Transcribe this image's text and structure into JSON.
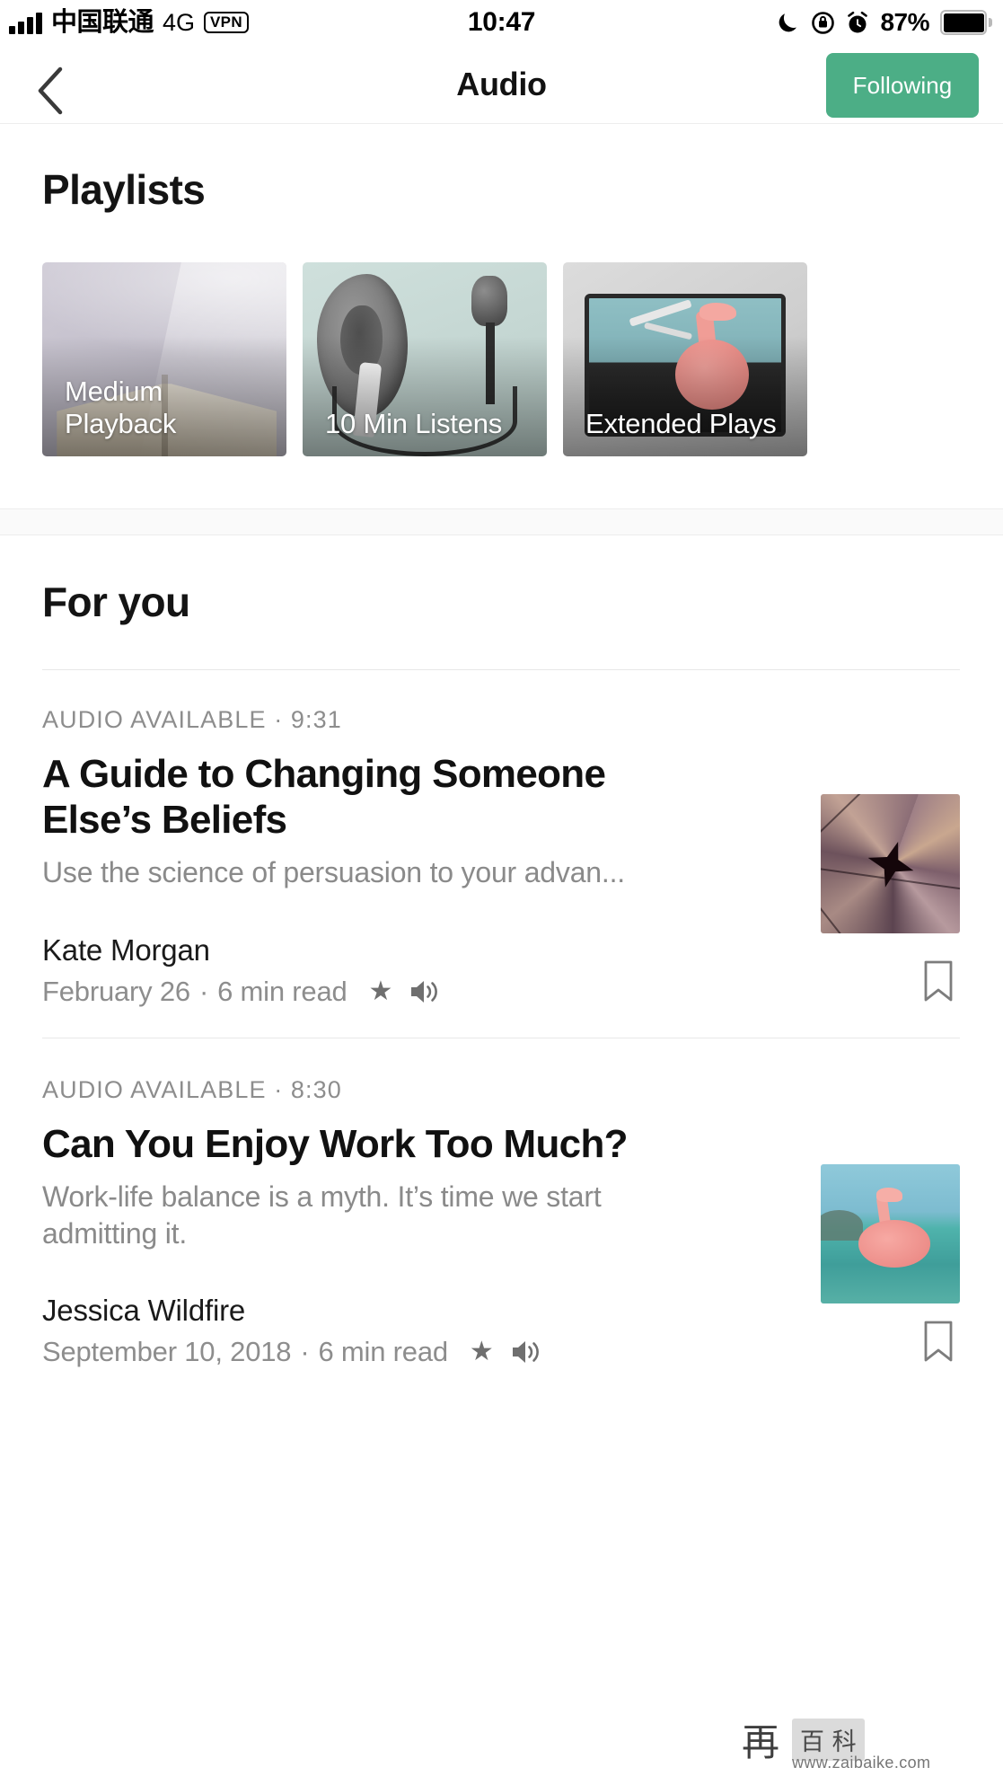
{
  "statusbar": {
    "carrier": "中国联通",
    "network": "4G",
    "vpn_badge": "VPN",
    "time": "10:47",
    "battery_percent": "87%",
    "icons": [
      "signal-bars-icon",
      "moon-icon",
      "rotation-lock-icon",
      "alarm-clock-icon",
      "battery-icon"
    ]
  },
  "navbar": {
    "back_icon": "chevron-left-icon",
    "title": "Audio",
    "follow_button": "Following",
    "accent_color": "#4cae86"
  },
  "playlists": {
    "heading": "Playlists",
    "cards": [
      {
        "label": "Medium\nPlayback",
        "art": "open-book-art"
      },
      {
        "label": "10 Min Listens",
        "art": "ear-earbud-microphone-art"
      },
      {
        "label": "Extended Plays",
        "art": "suitcase-flamingo-art"
      }
    ]
  },
  "for_you": {
    "heading": "For you",
    "articles": [
      {
        "kicker_label": "AUDIO AVAILABLE",
        "kicker_sep": "·",
        "duration": "9:31",
        "title": "A Guide to Changing Someone Else’s Beliefs",
        "dek": "Use the science of persuasion to your advan...",
        "author": "Kate Morgan",
        "date": "February 26",
        "meta_sep": "·",
        "read_time": "6 min read",
        "star_icon": "star-icon",
        "speaker_icon": "speaker-icon",
        "bookmark_icon": "bookmark-icon",
        "thumb": "shattered-mirror-faces-art"
      },
      {
        "kicker_label": "AUDIO AVAILABLE",
        "kicker_sep": "·",
        "duration": "8:30",
        "title": "Can You Enjoy Work Too Much?",
        "dek": "Work-life balance is a myth. It’s time we start admitting it.",
        "author": "Jessica Wildfire",
        "date": "September 10, 2018",
        "meta_sep": "·",
        "read_time": "6 min read",
        "star_icon": "star-icon",
        "speaker_icon": "speaker-icon",
        "bookmark_icon": "bookmark-icon",
        "thumb": "flamingo-float-sea-art"
      }
    ]
  },
  "watermark": {
    "mark_cn": "再",
    "box_cn": "百 科",
    "url": "www.zaibaike.com"
  }
}
